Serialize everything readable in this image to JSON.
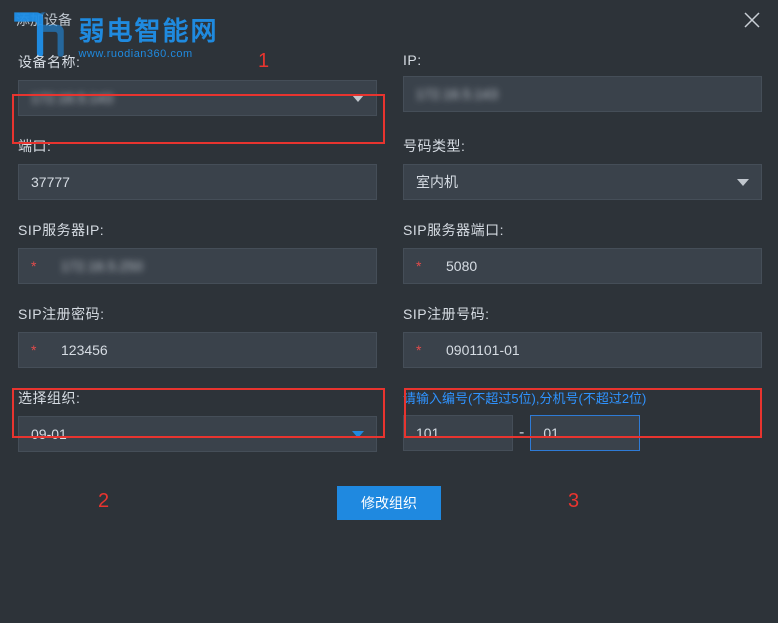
{
  "title": "添加设备",
  "watermark": {
    "cn": "弱电智能网",
    "en": "www.ruodian360.com"
  },
  "labels": {
    "device_name": "设备名称:",
    "ip": "IP:",
    "port": "端口:",
    "number_type": "号码类型:",
    "sip_server_ip": "SIP服务器IP:",
    "sip_server_port": "SIP服务器端口:",
    "sip_reg_pwd": "SIP注册密码:",
    "sip_reg_no": "SIP注册号码:",
    "select_org": "选择组织:",
    "hint": "请输入编号(不超过5位),分机号(不超过2位)"
  },
  "values": {
    "device_name": "172.16.5.143",
    "ip": "172.16.5.143",
    "port": "37777",
    "number_type": "室内机",
    "sip_server_ip": "172.16.5.250",
    "sip_server_port": "5080",
    "sip_reg_pwd": "123456",
    "sip_reg_no": "0901101-01",
    "select_org": "09-01",
    "ext_main": "101",
    "ext_sub": "01"
  },
  "buttons": {
    "modify_org": "修改组织"
  },
  "annotations": {
    "a1": "1",
    "a2": "2",
    "a3": "3"
  }
}
